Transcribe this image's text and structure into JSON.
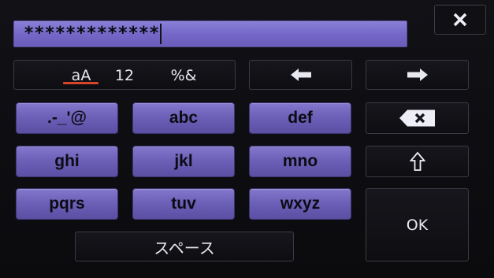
{
  "password": {
    "value": "*************"
  },
  "close": {
    "icon": "close-icon"
  },
  "modes": [
    {
      "label": "aA",
      "selected": true
    },
    {
      "label": "12",
      "selected": false
    },
    {
      "label": "%&",
      "selected": false
    }
  ],
  "colors": {
    "key_fill": "#7266c4",
    "field_fill": "#7b6fcf",
    "selected_underline": "#d9452a",
    "background": "#0d0d10"
  },
  "nav": {
    "left_icon": "arrow-left-icon",
    "right_icon": "arrow-right-icon",
    "backspace_icon": "backspace-icon",
    "shift_icon": "shift-arrow-icon"
  },
  "keys": [
    {
      "label": ".-_'@"
    },
    {
      "label": "abc"
    },
    {
      "label": "def"
    },
    {
      "label": "ghi"
    },
    {
      "label": "jkl"
    },
    {
      "label": "mno"
    },
    {
      "label": "pqrs"
    },
    {
      "label": "tuv"
    },
    {
      "label": "wxyz"
    }
  ],
  "space": {
    "label": "スペース"
  },
  "ok": {
    "label": "OK"
  }
}
